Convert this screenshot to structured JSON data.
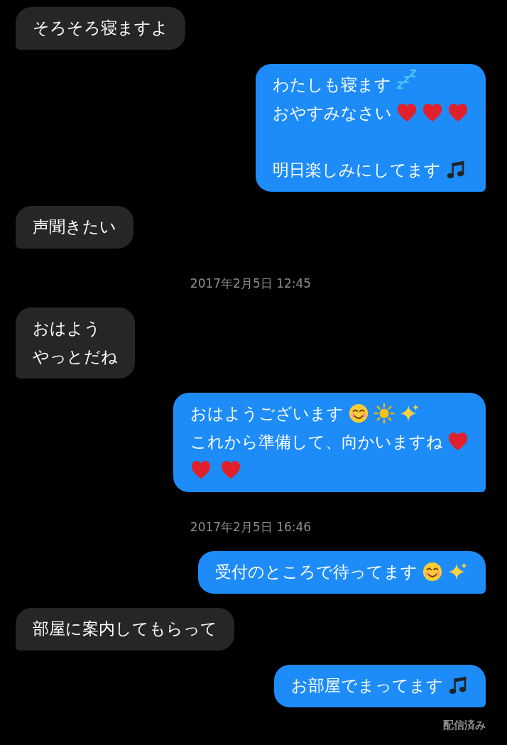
{
  "conversation": [
    {
      "kind": "incoming",
      "paragraphs": [
        [
          [
            {
              "kind": "text",
              "text": "そろそろ寝ますよ"
            }
          ]
        ]
      ]
    },
    {
      "kind": "outgoing",
      "paragraphs": [
        [
          [
            {
              "kind": "text",
              "text": "わたしも寝ます"
            },
            {
              "kind": "zzz"
            }
          ],
          [
            {
              "kind": "text",
              "text": "おやすみなさい"
            },
            {
              "kind": "heart"
            },
            {
              "kind": "heart"
            },
            {
              "kind": "heart"
            }
          ]
        ],
        [
          [
            {
              "kind": "text",
              "text": "明日楽しみにしてます"
            },
            {
              "kind": "note"
            }
          ]
        ]
      ]
    },
    {
      "kind": "incoming",
      "paragraphs": [
        [
          [
            {
              "kind": "text",
              "text": "声聞きたい"
            }
          ]
        ]
      ]
    },
    {
      "kind": "timestamp",
      "text": "2017年2月5日 12:45"
    },
    {
      "kind": "incoming",
      "paragraphs": [
        [
          [
            {
              "kind": "text",
              "text": "おはよう"
            }
          ],
          [
            {
              "kind": "text",
              "text": "やっとだね"
            }
          ]
        ]
      ]
    },
    {
      "kind": "outgoing",
      "paragraphs": [
        [
          [
            {
              "kind": "text",
              "text": "おはようございます"
            },
            {
              "kind": "smile"
            },
            {
              "kind": "sun"
            },
            {
              "kind": "sparkles"
            }
          ],
          [
            {
              "kind": "text",
              "text": "これから準備して、向かいますね"
            },
            {
              "kind": "heart"
            }
          ],
          [
            {
              "kind": "heart"
            },
            {
              "kind": "heart"
            }
          ]
        ]
      ]
    },
    {
      "kind": "timestamp",
      "text": "2017年2月5日 16:46"
    },
    {
      "kind": "outgoing",
      "paragraphs": [
        [
          [
            {
              "kind": "text",
              "text": "受付のところで待ってます"
            },
            {
              "kind": "smile"
            },
            {
              "kind": "sparkles"
            }
          ]
        ]
      ]
    },
    {
      "kind": "incoming",
      "paragraphs": [
        [
          [
            {
              "kind": "text",
              "text": "部屋に案内してもらって"
            }
          ]
        ]
      ]
    },
    {
      "kind": "outgoing",
      "paragraphs": [
        [
          [
            {
              "kind": "text",
              "text": "お部屋でまってます"
            },
            {
              "kind": "note"
            }
          ]
        ]
      ]
    },
    {
      "kind": "status",
      "text": "配信済み"
    }
  ]
}
